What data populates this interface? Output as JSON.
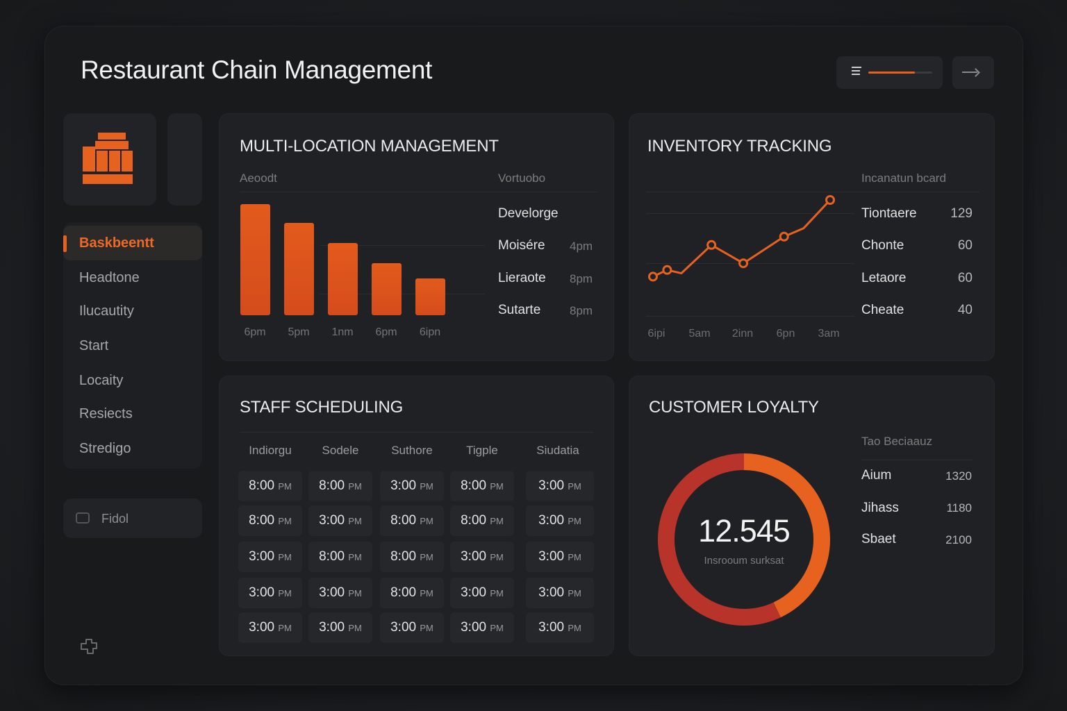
{
  "header": {
    "title": "Restaurant Chain Management",
    "progress_fraction": 0.73
  },
  "sidebar": {
    "nav": [
      {
        "label": "Baskbeentt",
        "active": true
      },
      {
        "label": "Headtone"
      },
      {
        "label": "Ilucautity"
      },
      {
        "label": "Start"
      },
      {
        "label": "Locaity"
      },
      {
        "label": "Resiects"
      },
      {
        "label": "Stredigo"
      }
    ],
    "feed_label": "Fidol"
  },
  "multi_location": {
    "title": "MULTI-LOCATION MANAGEMENT",
    "col_left": "Aeoodt",
    "col_right": "Vortuobo",
    "rows": [
      {
        "name": "Develorge",
        "time": ""
      },
      {
        "name": "Moisére",
        "time": "4pm"
      },
      {
        "name": "Lieraote",
        "time": "8pm"
      },
      {
        "name": "Sutarte",
        "time": "8pm"
      }
    ]
  },
  "inventory": {
    "title": "INVENTORY TRACKING",
    "col_header": "Incanatun bcard",
    "rows": [
      {
        "name": "Tiontaere",
        "value": "129"
      },
      {
        "name": "Chonte",
        "value": "60"
      },
      {
        "name": "Letaore",
        "value": "60"
      },
      {
        "name": "Cheate",
        "value": "40"
      }
    ]
  },
  "staff": {
    "title": "STAFF SCHEDULING",
    "headers": [
      "Indiorgu",
      "Sodele",
      "Suthore",
      "Tigple",
      "Siudatia"
    ],
    "rows": [
      [
        [
          "8:00",
          "PM"
        ],
        [
          "8:00",
          "PM"
        ],
        [
          "3:00",
          "PM"
        ],
        [
          "8:00",
          "PM"
        ],
        [
          "3:00",
          "PM"
        ]
      ],
      [
        [
          "8:00",
          "PM"
        ],
        [
          "3:00",
          "PM"
        ],
        [
          "8:00",
          "PM"
        ],
        [
          "8:00",
          "PM"
        ],
        [
          "3:00",
          "PM"
        ]
      ],
      [
        [
          "3:00",
          "PM"
        ],
        [
          "8:00",
          "PM"
        ],
        [
          "8:00",
          "PM"
        ],
        [
          "3:00",
          "PM"
        ],
        [
          "3:00",
          "PM"
        ]
      ],
      [
        [
          "3:00",
          "PM"
        ],
        [
          "3:00",
          "PM"
        ],
        [
          "8:00",
          "PM"
        ],
        [
          "3:00",
          "PM"
        ],
        [
          "3:00",
          "PM"
        ]
      ],
      [
        [
          "3:00",
          "PM"
        ],
        [
          "3:00",
          "PM"
        ],
        [
          "3:00",
          "PM"
        ],
        [
          "3:00",
          "PM"
        ],
        [
          "3:00",
          "PM"
        ]
      ]
    ]
  },
  "loyalty": {
    "title": "CUSTOMER LOYALTY",
    "col_header": "Tao Beciaauz",
    "center_value": "12.545",
    "center_caption": "Insrooum surksat",
    "rows": [
      {
        "name": "Aium",
        "value": "1320"
      },
      {
        "name": "Jihass",
        "value": "1180"
      },
      {
        "name": "Sbaet",
        "value": "2100"
      }
    ]
  },
  "colors": {
    "accent": "#e8621f",
    "accent_dark": "#b8342a",
    "card": "#202124",
    "frame": "#191a1c"
  },
  "chart_data": [
    {
      "type": "bar",
      "categories": [
        "6pm",
        "5pm",
        "1nm",
        "6pm",
        "6ipn"
      ],
      "values": [
        100,
        83,
        65,
        47,
        33
      ],
      "title": "",
      "ylim": [
        0,
        110
      ]
    },
    {
      "type": "line",
      "x": [
        "6ipi",
        "5am",
        "2inn",
        "6pn",
        "3am"
      ],
      "series": [
        {
          "values": [
            8,
            16,
            12,
            46,
            24,
            56,
            66,
            100
          ],
          "x_pos": [
            0,
            0.08,
            0.16,
            0.33,
            0.51,
            0.74,
            0.85,
            1.0
          ]
        }
      ],
      "title": "",
      "ylim": [
        0,
        110
      ]
    },
    {
      "type": "pie",
      "categories": [
        "orange segment",
        "red segment"
      ],
      "values": [
        43,
        57
      ],
      "title": ""
    }
  ]
}
